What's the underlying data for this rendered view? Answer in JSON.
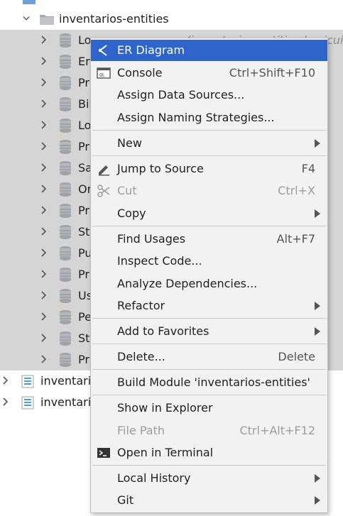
{
  "tree": {
    "top_partial_label": "inventarios-entities",
    "module_label": "inventarios-entities",
    "child_items": [
      {
        "label": "Lo",
        "tail": "(inventarios.entities.basicui)"
      },
      {
        "label": "En"
      },
      {
        "label": "Pr"
      },
      {
        "label": "Bil"
      },
      {
        "label": "Lo"
      },
      {
        "label": "Pr"
      },
      {
        "label": "Sa"
      },
      {
        "label": "Or"
      },
      {
        "label": "Pr"
      },
      {
        "label": "St"
      },
      {
        "label": "Pu"
      },
      {
        "label": "Pr"
      },
      {
        "label": "Us"
      },
      {
        "label": "Pe"
      },
      {
        "label": "St"
      },
      {
        "label": "Pr"
      }
    ],
    "sibling_modules": [
      {
        "label": "inventarios"
      },
      {
        "label": "inventarios"
      }
    ]
  },
  "menu": {
    "items": [
      {
        "label": "ER Diagram",
        "shortcut": "",
        "icon": "er-diagram-icon",
        "highlighted": true
      },
      {
        "label": "Console",
        "shortcut": "Ctrl+Shift+F10",
        "icon": "console-icon"
      },
      {
        "label": "Assign Data Sources...",
        "shortcut": ""
      },
      {
        "label": "Assign Naming Strategies...",
        "shortcut": ""
      },
      {
        "label": "New",
        "shortcut": "",
        "submenu": true
      },
      {
        "label": "Jump to Source",
        "shortcut": "F4",
        "icon": "pencil-icon"
      },
      {
        "label": "Cut",
        "shortcut": "Ctrl+X",
        "icon": "scissors-icon",
        "disabled": true
      },
      {
        "label": "Copy",
        "shortcut": "",
        "submenu": true
      },
      {
        "label": "Find Usages",
        "shortcut": "Alt+F7"
      },
      {
        "label": "Inspect Code...",
        "shortcut": ""
      },
      {
        "label": "Analyze Dependencies...",
        "shortcut": ""
      },
      {
        "label": "Refactor",
        "shortcut": "",
        "submenu": true
      },
      {
        "label": "Add to Favorites",
        "shortcut": "",
        "submenu": true
      },
      {
        "label": "Delete...",
        "shortcut": "Delete"
      },
      {
        "label": "Build Module 'inventarios-entities'",
        "shortcut": ""
      },
      {
        "label": "Show in Explorer",
        "shortcut": ""
      },
      {
        "label": "File Path",
        "shortcut": "Ctrl+Alt+F12",
        "disabled": true
      },
      {
        "label": "Open in Terminal",
        "shortcut": "",
        "icon": "terminal-icon"
      },
      {
        "label": "Local History",
        "shortcut": "",
        "submenu": true
      },
      {
        "label": "Git",
        "shortcut": "",
        "submenu": true
      }
    ]
  },
  "colors": {
    "highlight": "#2f65ca",
    "selection_bg": "#d5d5d5",
    "menu_bg": "#f2f2f2"
  }
}
